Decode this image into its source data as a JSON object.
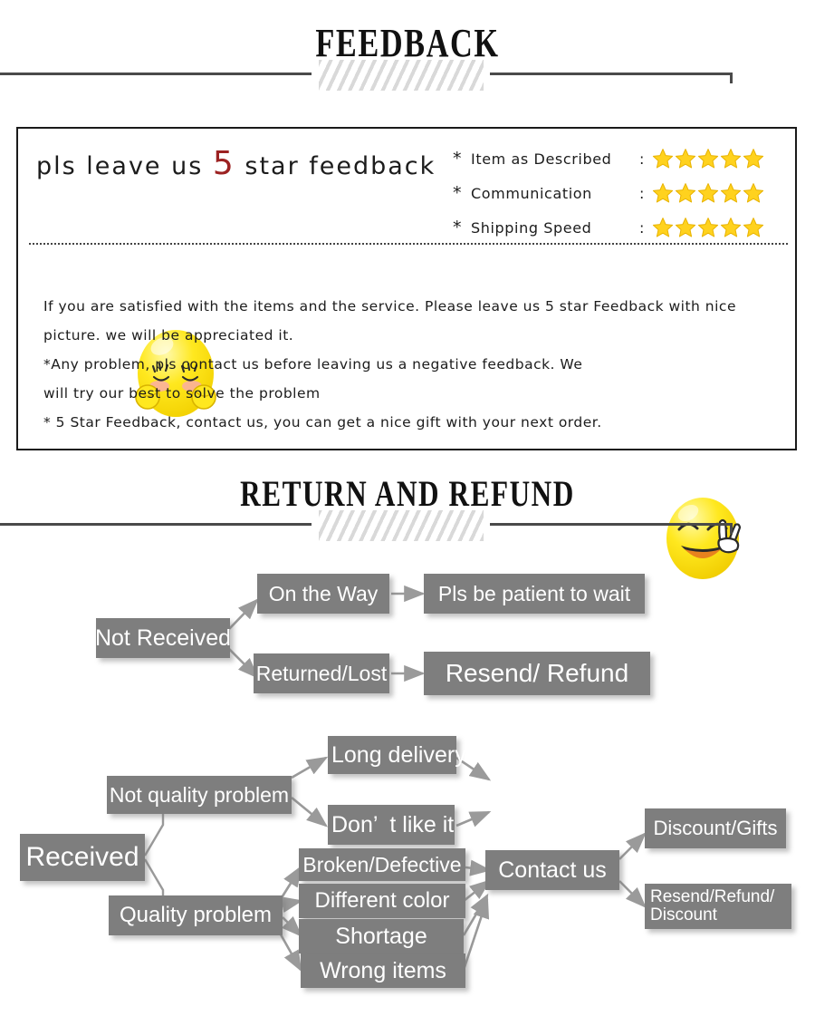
{
  "sections": {
    "feedback_title": "FEEDBACK",
    "return_title": "RETURN  AND  REFUND"
  },
  "feedback": {
    "headline_before": "pls  leave  us  ",
    "headline_number": "5",
    "headline_after": "  star  feedback",
    "ratings": [
      {
        "asterisk": "*",
        "label": "Item as Described",
        "colon": ":",
        "stars": 5
      },
      {
        "asterisk": "*",
        "label": "Communication",
        "colon": ":",
        "stars": 5
      },
      {
        "asterisk": "*",
        "label": "Shipping Speed",
        "colon": ":",
        "stars": 5
      }
    ],
    "body_lines": [
      "If you are satisfied with the items and the service. Please leave us 5 star Feedback with nice",
      "picture. we will be appreciated it.",
      "*Any problem, pls contact us before leaving us a negative feedback. We",
      "will try our best to solve  the problem",
      "* 5 Star Feedback, contact us, you can get a nice gift with your next order."
    ],
    "icons": {
      "shy_smiley": "shy-smiley-icon",
      "peace_smiley": "peace-smiley-icon"
    }
  },
  "flow": {
    "not_received": {
      "root": "Not Received",
      "on_the_way": "On the Way",
      "on_the_way_result": "Pls be patient to wait",
      "returned_lost": "Returned/Lost",
      "returned_lost_result": "Resend/ Refund"
    },
    "received": {
      "root": "Received",
      "not_quality": "Not quality problem",
      "quality": "Quality problem",
      "long_delivery": "Long delivery",
      "dont_like": "Don’  t like it",
      "broken": "Broken/Defective",
      "different_color": "Different color",
      "shortage": "Shortage",
      "wrong_items": "Wrong items",
      "contact_us": "Contact us",
      "discount_gifts": "Discount/Gifts",
      "resend_refund_line1": "Resend/Refund/",
      "resend_refund_line2": "Discount"
    }
  },
  "colors": {
    "node_fill": "#7e7e7e",
    "node_text": "#ffffff",
    "star": "#ffd21e",
    "star_stroke": "#e8b300",
    "accent_red": "#9c2222",
    "rule": "#4a4a4a",
    "hatch": "#d9d9d9"
  }
}
